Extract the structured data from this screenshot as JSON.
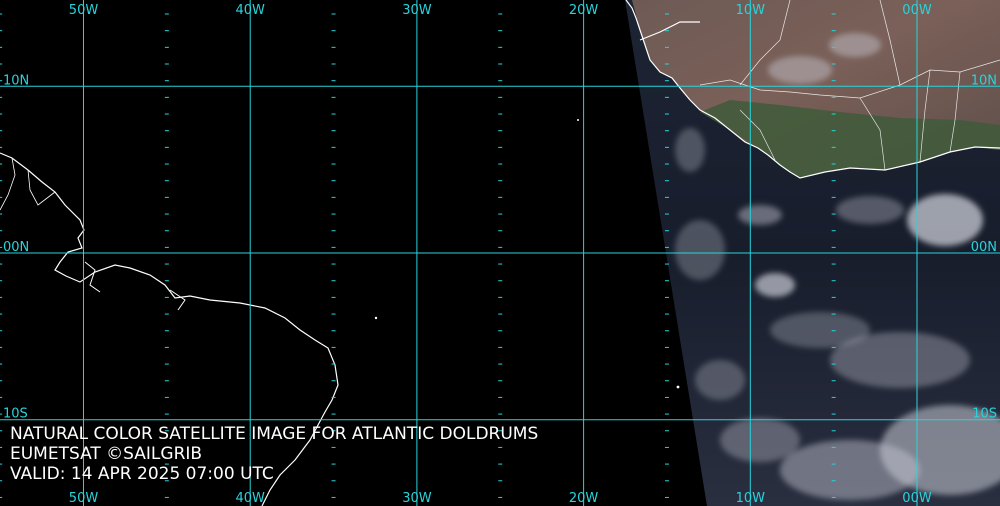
{
  "map": {
    "longitude_lines": [
      {
        "label": "50W",
        "lon": -50
      },
      {
        "label": "40W",
        "lon": -40
      },
      {
        "label": "30W",
        "lon": -30
      },
      {
        "label": "20W",
        "lon": -20
      },
      {
        "label": "10W",
        "lon": -10
      },
      {
        "label": "00W",
        "lon": 0
      }
    ],
    "latitude_lines": [
      {
        "label": "10N",
        "lat": 10
      },
      {
        "label": "00N",
        "lat": 0
      },
      {
        "label": "10S",
        "lat": -10
      }
    ],
    "grid_color": "#28d4dc",
    "coast_color": "#ffffff"
  },
  "caption": {
    "title": "NATURAL COLOR SATELLITE IMAGE FOR ATLANTIC DOLDRUMS",
    "credit": "EUMETSAT ©SAILGRIB",
    "valid": "VALID:  14 APR 2025 07:00 UTC"
  }
}
